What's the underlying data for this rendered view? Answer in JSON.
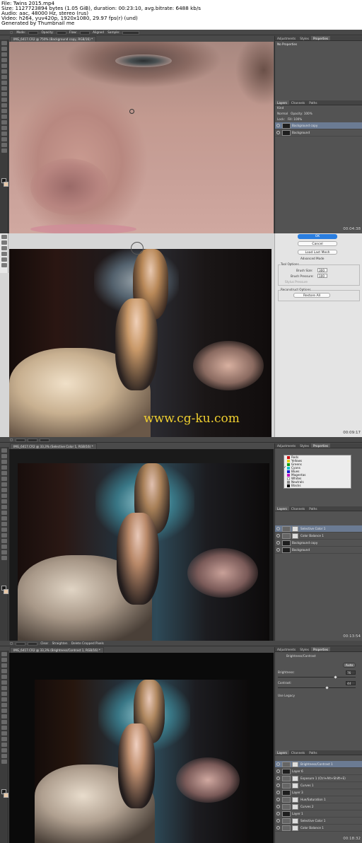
{
  "header": {
    "file": "File: Twins 2015.mp4",
    "size": "Size: 1127723894 bytes (1.05 GiB), duration: 00:23:10, avg.bitrate: 6488 kb/s",
    "audio": "Audio: aac, 48000 Hz, stereo (rus)",
    "video": "Video: h264, yuv420p, 1920x1080, 29.97 fps(r) (und)",
    "generated": "Generated by Thumbnail me"
  },
  "frame1": {
    "options": {
      "mode": "Mode:",
      "mode_val": "Normal",
      "opacity": "Opacity:",
      "opacity_val": "100%",
      "flow": "Flow:",
      "flow_val": "100%",
      "aligned": "Aligned",
      "sample": "Sample:",
      "sample_val": "Current Layer"
    },
    "doc_tab": "IMG_6417.CR2 @ 750% (Background copy, RGB/16) *",
    "panel_tabs": [
      "Adjustments",
      "Styles",
      "Properties"
    ],
    "properties_text": "No Properties",
    "layers_tabs": [
      "Layers",
      "Channels",
      "Paths"
    ],
    "kind": "Kind",
    "blend": "Normal",
    "opacity": "Opacity: 100%",
    "lock": "Lock:",
    "fill": "Fill: 100%",
    "layers": [
      "Background copy",
      "Background"
    ],
    "timestamp": "00:04:38"
  },
  "frame2": {
    "ok": "OK",
    "cancel": "Cancel",
    "load_mesh": "Load Last Mesh",
    "advanced": "Advanced Mode",
    "tool_options": "Tool Options",
    "brush_size": "Brush Size:",
    "brush_size_val": "300",
    "brush_pressure": "Brush Pressure:",
    "brush_pressure_val": "100",
    "stylus": "Stylus Pressure",
    "reconstruct": "Reconstruct Options",
    "restore_all": "Restore All",
    "watermark": "www.cg-ku.com",
    "timestamp": "00:09:17"
  },
  "frame3": {
    "doc_tab": "IMG_6417.CR2 @ 33,3% (Selective Color 1, RGB/16) *",
    "panel_tabs": [
      "Adjustments",
      "Styles",
      "Properties"
    ],
    "colors": [
      {
        "name": "Reds",
        "swatch": "#d01010"
      },
      {
        "name": "Yellows",
        "swatch": "#e8d010"
      },
      {
        "name": "Greens",
        "swatch": "#10a010"
      },
      {
        "name": "Cyans",
        "swatch": "#10c0d0"
      },
      {
        "name": "Blues",
        "swatch": "#1020d0"
      },
      {
        "name": "Magentas",
        "swatch": "#c010c0"
      },
      {
        "name": "Whites",
        "swatch": "#ffffff"
      },
      {
        "name": "Neutrals",
        "swatch": "#888888"
      },
      {
        "name": "Blacks",
        "swatch": "#000000"
      }
    ],
    "selected_color": "Cyans",
    "layers_tabs": [
      "Layers",
      "Channels",
      "Paths"
    ],
    "layers": [
      "Selective Color 1",
      "Color Balance 1",
      "Background copy",
      "Background"
    ],
    "timestamp": "00:13:54"
  },
  "frame4": {
    "options": {
      "clear": "Clear",
      "straighten": "Straighten",
      "delete_cropped": "Delete Cropped Pixels"
    },
    "doc_tab": "IMG_6417.CR2 @ 33,3% (Brightness/Contrast 1, RGB/16) *",
    "panel_tabs": [
      "Adjustments",
      "Styles",
      "Properties"
    ],
    "prop_title": "Brightness/Contrast",
    "auto": "Auto",
    "brightness": "Brightness:",
    "brightness_val": "76",
    "contrast": "Contrast:",
    "contrast_val": "44",
    "use_legacy": "Use Legacy",
    "layers_tabs": [
      "Layers",
      "Channels",
      "Paths"
    ],
    "layers": [
      "Brightness/Contrast 1",
      "Layer 6",
      "Exposure 1 (Ctrl+Alt+Shift+E)",
      "Curves 1",
      "Layer 3",
      "Hue/Saturation 1",
      "Curves 2",
      "Layer 1",
      "Selective Color 1",
      "Color Balance 1"
    ],
    "timestamp": "00:18:32"
  }
}
